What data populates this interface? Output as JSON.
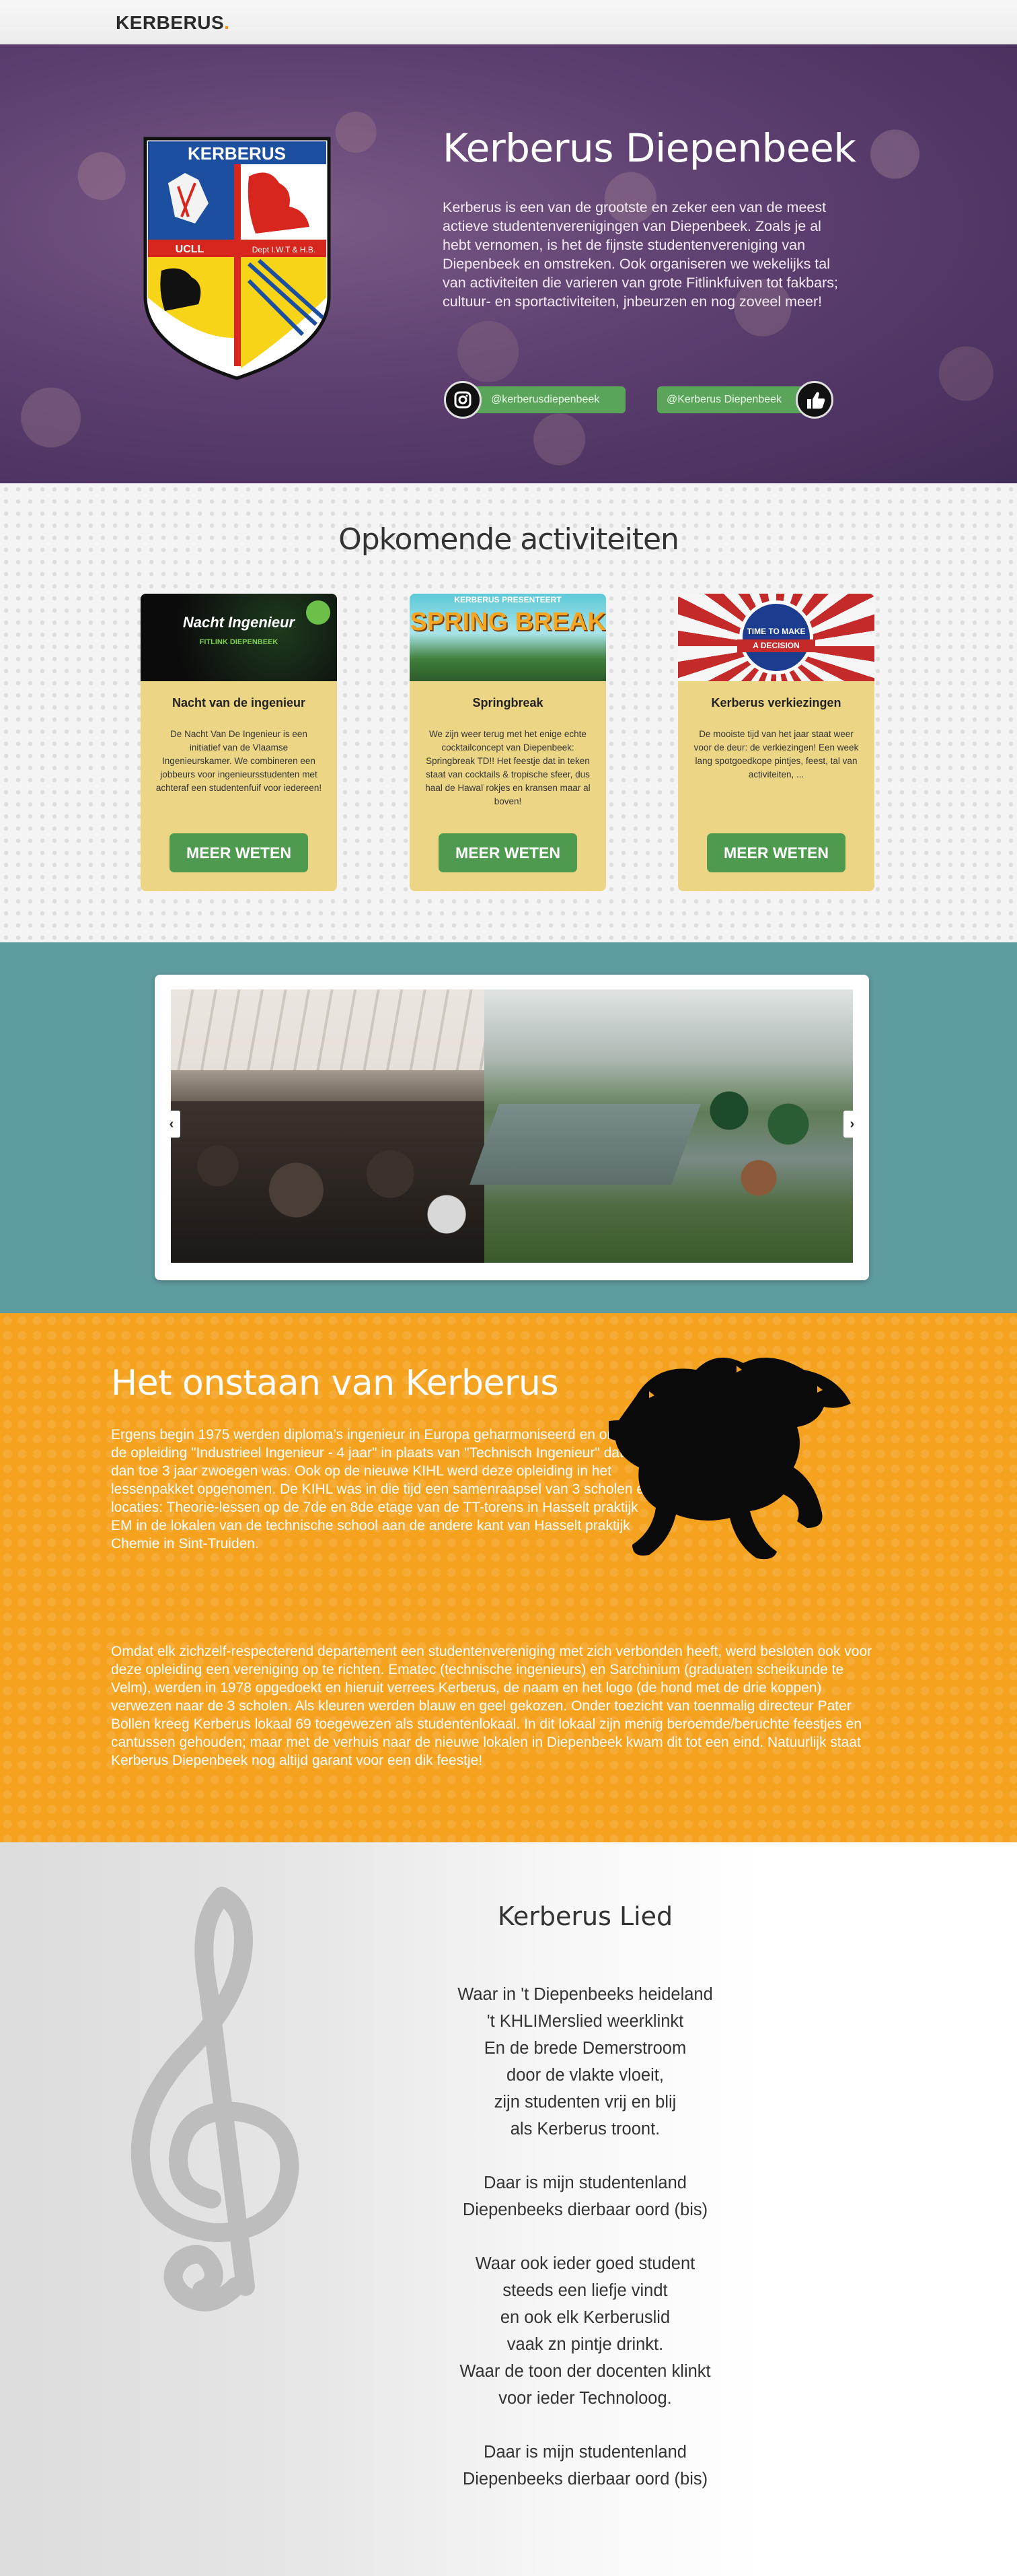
{
  "nav": {
    "brand": "KERBERUS",
    "brand_dot": "."
  },
  "hero": {
    "title": "Kerberus Diepenbeek",
    "text": "Kerberus is een van de grootste en zeker een van de meest actieve studentenverenigingen van Diepenbeek. Zoals je al hebt vernomen, is het de fijnste studentenvereniging van Diepenbeek en omstreken. Ook organiseren we wekelijks tal van activiteiten die varieren van grote Fitlinkfuiven tot fakbars; cultuur- en sportactiviteiten, jnbeurzen en nog zoveel meer!",
    "shield": {
      "banner": "KERBERUS",
      "left_label": "UCLL",
      "right_label": "Dept I.W.T & H.B."
    },
    "instagram": "@kerberusdiepenbeek",
    "facebook": "@Kerberus Diepenbeek"
  },
  "activities": {
    "heading": "Opkomende activiteiten",
    "cards": [
      {
        "title": "Nacht van de ingenieur",
        "text": "De Nacht Van De Ingenieur is een initiatief van de Vlaamse Ingenieurskamer. We combineren een jobbeurs voor ingenieursstudenten met achteraf een studentenfuif voor iedereen!",
        "button": "MEER WETEN",
        "image_title": "Nacht Ingenieur",
        "image_sub": "FITLINK DIEPENBEEK"
      },
      {
        "title": "Springbreak",
        "text": "We zijn weer terug met het enige echte cocktailconcept van Diepenbeek: Springbreak TD!! Het feestje dat in teken staat van cocktails & tropische sfeer, dus haal de Hawaï rokjes en kransen maar al boven!",
        "button": "MEER WETEN",
        "image_top": "KERBERUS PRESENTEERT",
        "image_title": "SPRING BREAK"
      },
      {
        "title": "Kerberus verkiezingen",
        "text": "De mooiste tijd van het jaar staat weer voor de deur: de verkiezingen! Een week lang spotgoedkope pintjes, feest, tal van activiteiten, ...",
        "button": "MEER WETEN",
        "image_title": "TIME TO MAKE",
        "image_sub": "A DECISION"
      }
    ]
  },
  "slider": {
    "prev": "‹",
    "next": "›"
  },
  "history": {
    "heading": "Het onstaan van Kerberus",
    "p1": "Ergens begin 1975 werden diploma’s ingenieur in Europa geharmoniseerd en onstond de opleiding \"Industrieel Ingenieur - 4 jaar\" in plaats van \"Technisch Ingenieur\" dat tot dan toe 3 jaar zwoegen was. Ook op de nieuwe KIHL werd deze opleiding in het lessenpakket opgenomen. De KIHL was in die tijd een samenraapsel van 3 scholen en locaties: Theorie-lessen op de 7de en 8de etage van de TT-torens in Hasselt praktijk EM in de lokalen van de technische school aan de andere kant van Hasselt praktijk Chemie in Sint-Truiden.",
    "p2": "Omdat elk zichzelf-respecterend departement een studentenvereniging met zich verbonden heeft, werd besloten ook voor deze opleiding een vereniging op te richten. Ematec (technische ingenieurs) en Sarchinium (graduaten scheikunde te Velm), werden in 1978 opgedoekt en hieruit verrees Kerberus, de naam en het logo (de hond met de drie koppen) verwezen naar de 3 scholen. Als kleuren werden blauw en geel gekozen. Onder toezicht van toenmalig directeur Pater Bollen kreeg Kerberus lokaal 69 toegewezen als studentenlokaal. In dit lokaal zijn menig beroemde/beruchte feestjes en cantussen gehouden; maar met de verhuis naar de nieuwe lokalen in Diepenbeek kwam dit tot een eind. Natuurlijk staat Kerberus Diepenbeek nog altijd garant voor een dik feestje!"
  },
  "song": {
    "heading": "Kerberus Lied",
    "stanzas": [
      [
        "Waar in 't Diepenbeeks heideland",
        "'t KHLIMerslied weerklinkt",
        "En de brede Demerstroom",
        "door de vlakte vloeit,",
        "zijn studenten vrij en blij",
        "als Kerberus troont."
      ],
      [
        "Daar is mijn studentenland",
        "Diepenbeeks dierbaar oord (bis)"
      ],
      [
        "Waar ook ieder goed student",
        "steeds een liefje vindt",
        "en ook elk Kerberuslid",
        "vaak zn pintje drinkt.",
        "Waar de toon der docenten klinkt",
        "voor ieder Technoloog."
      ],
      [
        "Daar is mijn studentenland",
        "Diepenbeeks dierbaar oord (bis)"
      ]
    ]
  }
}
